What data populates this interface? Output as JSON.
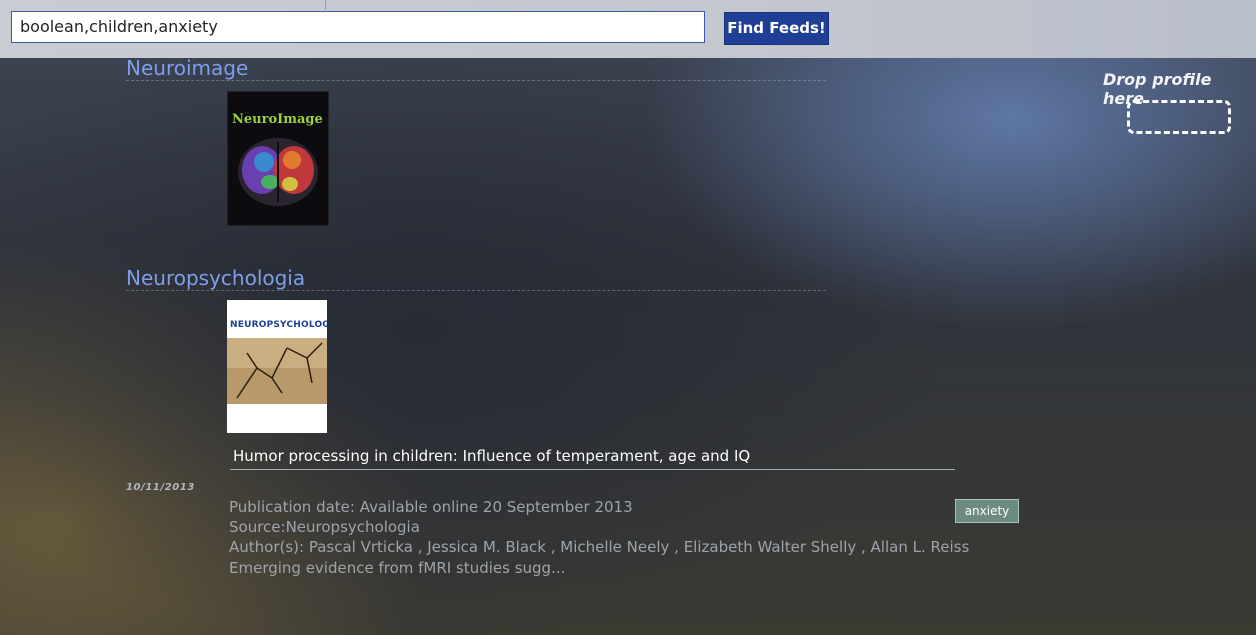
{
  "search": {
    "value": "boolean,children,anxiety",
    "button_label": "Find Feeds!"
  },
  "dropzone": {
    "label": "Drop profile here"
  },
  "journals": [
    {
      "name": "Neuroimage",
      "cover_title": "NeuroImage"
    },
    {
      "name": "Neuropsychologia",
      "cover_title": "NEUROPSYCHOLOGIA"
    }
  ],
  "article": {
    "title": "Humor processing in children: Influence of temperament, age and IQ",
    "date": "10/11/2013",
    "publication_date": "Publication date: Available online 20 September 2013",
    "source": "Source:Neuropsychologia",
    "authors": "Author(s): Pascal Vrticka , Jessica M. Black , Michelle Neely , Elizabeth Walter Shelly , Allan L. Reiss",
    "snippet": "Emerging evidence from fMRI studies sugg...",
    "tag": "anxiety"
  },
  "colors": {
    "accent": "#1f3f96",
    "journal_title": "#7e9ee8",
    "tag": "#6c8c80"
  }
}
